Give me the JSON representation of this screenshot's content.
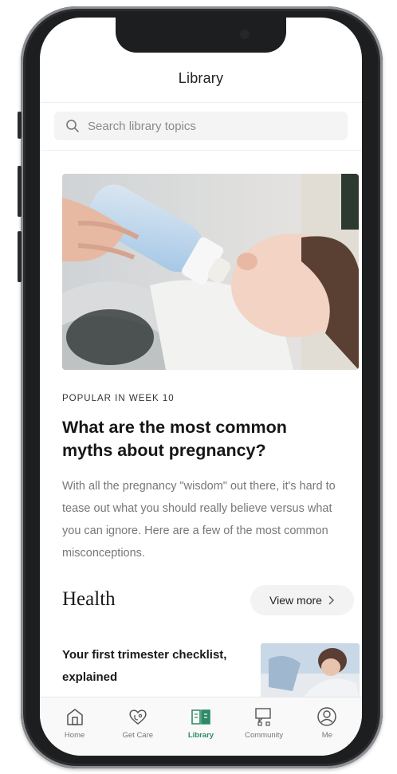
{
  "header": {
    "title": "Library"
  },
  "search": {
    "placeholder": "Search library topics"
  },
  "featured": {
    "kicker": "POPULAR IN WEEK 10",
    "title": "What are the most common myths about pregnancy?",
    "summary": "With all the pregnancy \"wisdom\" out there, it's hard to tease out what you should really believe versus what you can ignore. Here are a few of the most common misconceptions."
  },
  "section": {
    "title": "Health",
    "view_more_label": "View more"
  },
  "article": {
    "title": "Your first trimester checklist, explained"
  },
  "tabs": [
    {
      "label": "Home",
      "icon": "home-icon"
    },
    {
      "label": "Get Care",
      "icon": "heart-stethoscope-icon"
    },
    {
      "label": "Library",
      "icon": "book-icon"
    },
    {
      "label": "Community",
      "icon": "chat-icon"
    },
    {
      "label": "Me",
      "icon": "profile-icon"
    }
  ],
  "colors": {
    "accent": "#2e8a66",
    "frame": "#1d1e20"
  }
}
